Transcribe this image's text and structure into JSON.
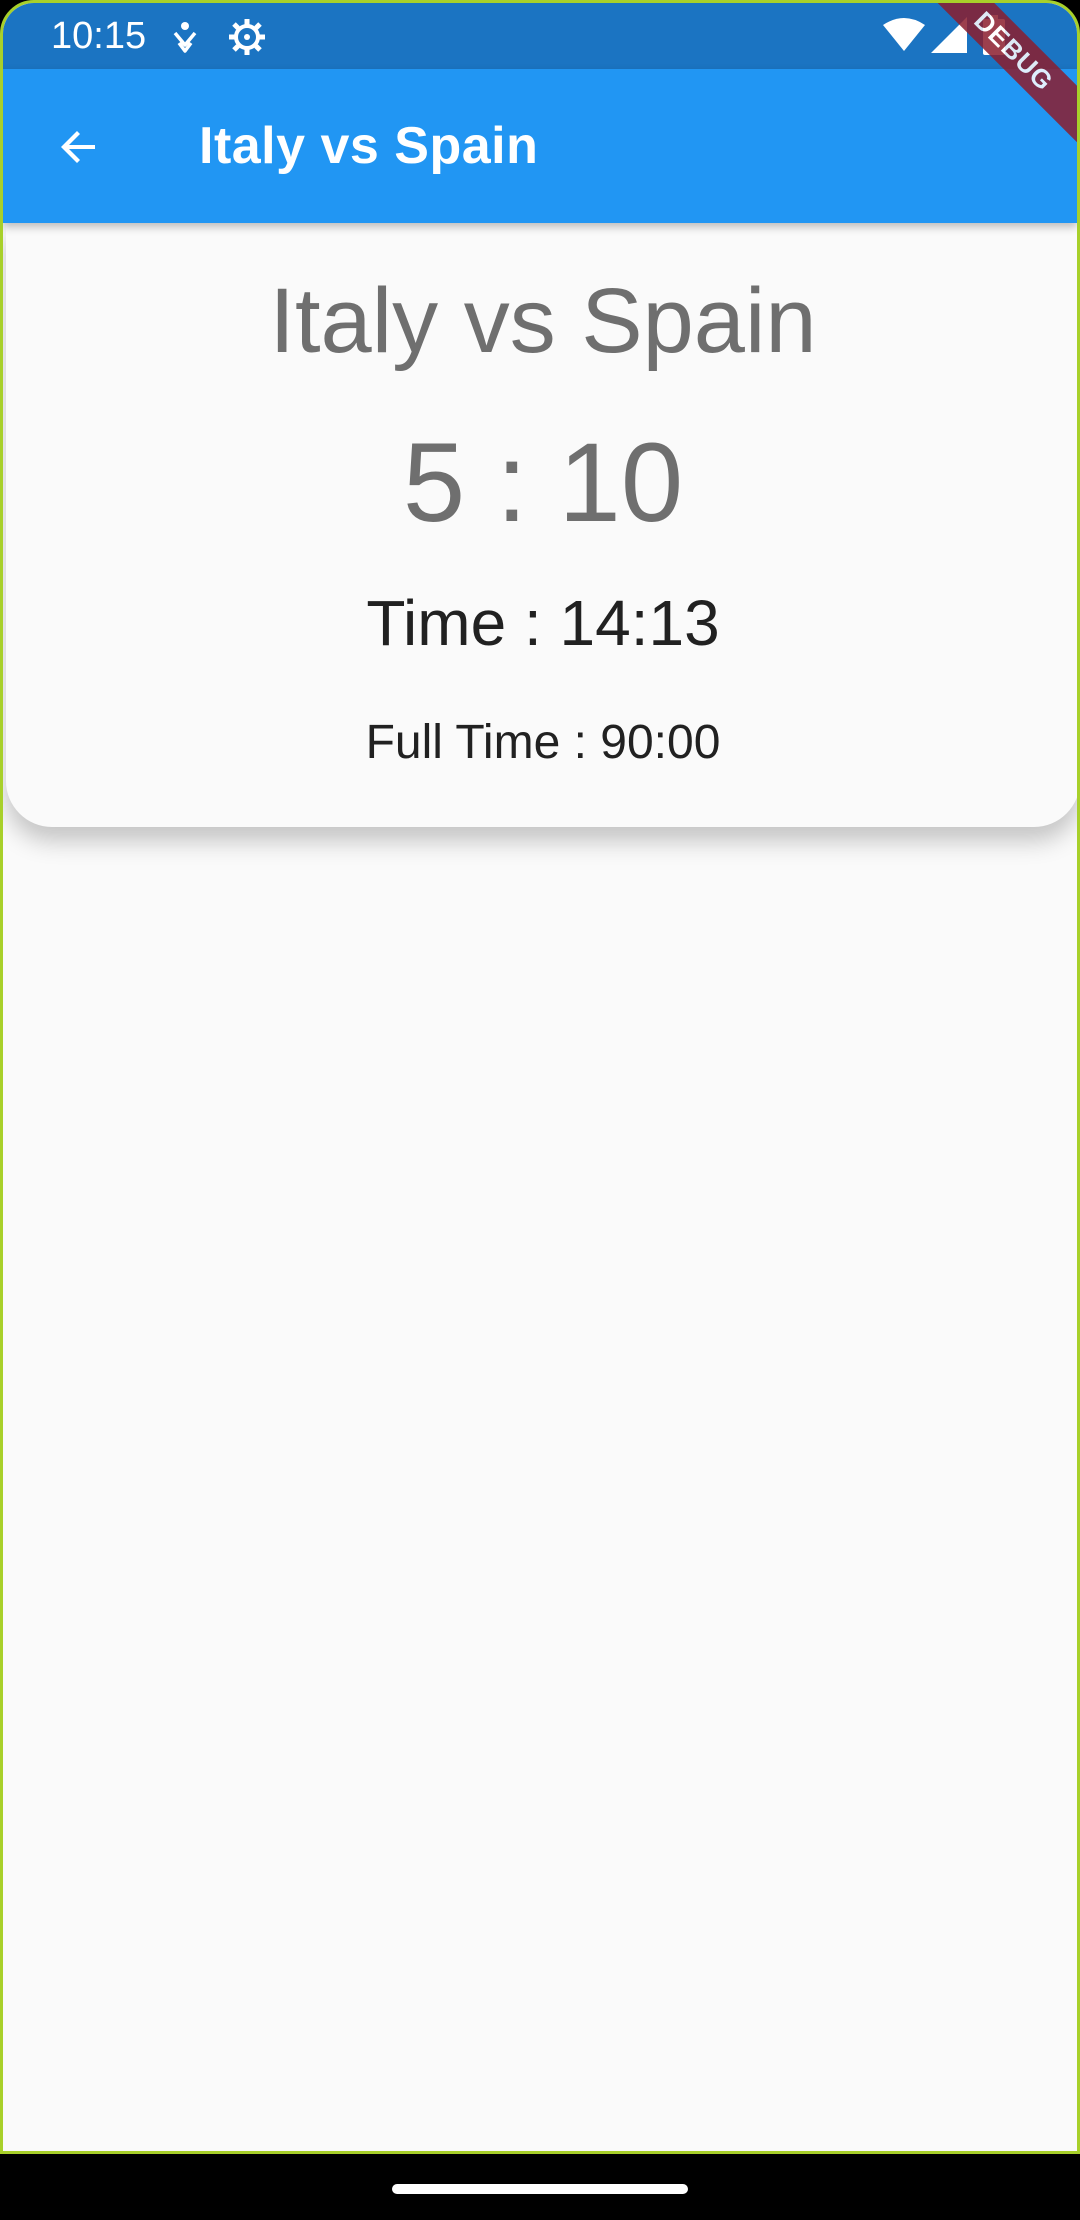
{
  "status_bar": {
    "time": "10:15",
    "icons": [
      "accessibility-icon",
      "settings-gear-icon",
      "wifi-icon",
      "signal-icon",
      "battery-icon"
    ]
  },
  "app_bar": {
    "back_icon": "arrow-back-icon",
    "title": "Italy vs Spain",
    "color": "#2196f3"
  },
  "debug_banner": {
    "label": "DEBUG"
  },
  "match": {
    "title": "Italy vs Spain",
    "score": "5 : 10",
    "time": "Time : 14:13",
    "full_time": "Full Time : 90:00"
  }
}
